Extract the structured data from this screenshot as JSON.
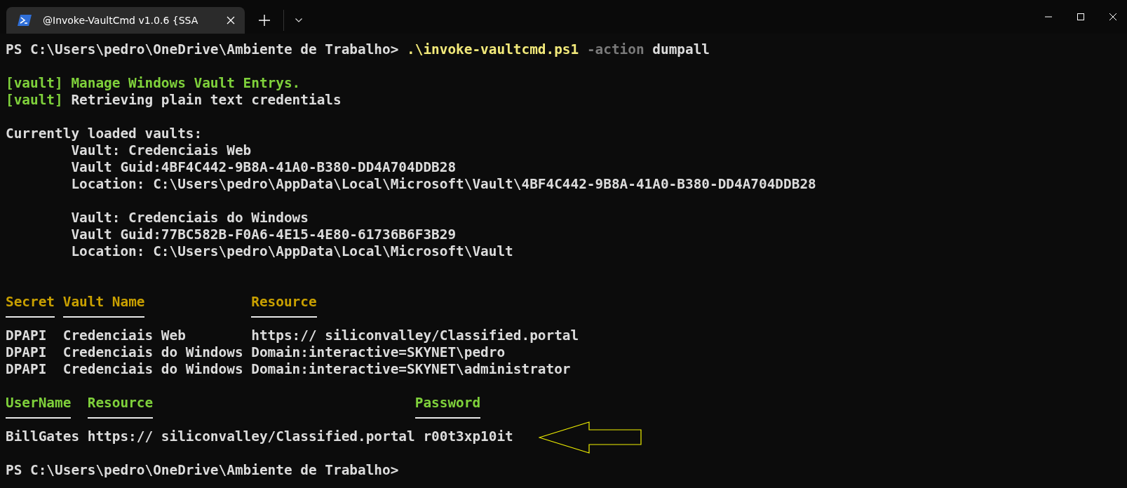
{
  "window": {
    "tab": {
      "title": "@Invoke-VaultCmd v1.0.6 {SSA",
      "selected": true
    }
  },
  "terminal": {
    "lines": [
      {
        "kind": "text",
        "segments": [
          {
            "text": "PS C:\\Users\\pedro\\OneDrive\\Ambiente de Trabalho> ",
            "color": "#dcdcdc"
          },
          {
            "text": ".\\invoke-vaultcmd.ps1",
            "color": "#f2e97a"
          },
          {
            "text": " -action",
            "color": "#7a7a7a"
          },
          {
            "text": " dumpall",
            "color": "#dcdcdc"
          }
        ]
      },
      {
        "kind": "blank"
      },
      {
        "kind": "text",
        "segments": [
          {
            "text": "[vault] Manage Windows Vault Entrys.",
            "color": "#7fd13b"
          }
        ]
      },
      {
        "kind": "text",
        "segments": [
          {
            "text": "[vault]",
            "color": "#7fd13b"
          },
          {
            "text": " Retrieving plain text credentials",
            "color": "#dcdcdc"
          }
        ]
      },
      {
        "kind": "blank"
      },
      {
        "kind": "text",
        "segments": [
          {
            "text": "Currently loaded vaults:",
            "color": "#dcdcdc"
          }
        ]
      },
      {
        "kind": "text",
        "segments": [
          {
            "text": "        Vault: Credenciais Web",
            "color": "#dcdcdc"
          }
        ]
      },
      {
        "kind": "text",
        "segments": [
          {
            "text": "        Vault Guid:4BF4C442-9B8A-41A0-B380-DD4A704DDB28",
            "color": "#dcdcdc"
          }
        ]
      },
      {
        "kind": "text",
        "segments": [
          {
            "text": "        Location: C:\\Users\\pedro\\AppData\\Local\\Microsoft\\Vault\\4BF4C442-9B8A-41A0-B380-DD4A704DDB28",
            "color": "#dcdcdc"
          }
        ]
      },
      {
        "kind": "blank"
      },
      {
        "kind": "text",
        "segments": [
          {
            "text": "        Vault: Credenciais do Windows",
            "color": "#dcdcdc"
          }
        ]
      },
      {
        "kind": "text",
        "segments": [
          {
            "text": "        Vault Guid:77BC582B-F0A6-4E15-4E80-61736B6F3B29",
            "color": "#dcdcdc"
          }
        ]
      },
      {
        "kind": "text",
        "segments": [
          {
            "text": "        Location: C:\\Users\\pedro\\AppData\\Local\\Microsoft\\Vault",
            "color": "#dcdcdc"
          }
        ]
      },
      {
        "kind": "blank"
      },
      {
        "kind": "blank"
      },
      {
        "kind": "header",
        "segments": [
          {
            "text": "Secret ",
            "color": "#c9a000"
          },
          {
            "text": "Vault Name             ",
            "color": "#c9a000"
          },
          {
            "text": "Resource",
            "color": "#c9a000"
          }
        ]
      },
      {
        "kind": "underline"
      },
      {
        "kind": "text",
        "segments": [
          {
            "text": "DPAPI  Credenciais Web        https:// siliconvalley/Classified.portal",
            "color": "#dcdcdc"
          }
        ]
      },
      {
        "kind": "text",
        "segments": [
          {
            "text": "DPAPI  Credenciais do Windows Domain:interactive=SKYNET\\pedro",
            "color": "#dcdcdc"
          }
        ]
      },
      {
        "kind": "text",
        "segments": [
          {
            "text": "DPAPI  Credenciais do Windows Domain:interactive=SKYNET\\administrator",
            "color": "#dcdcdc"
          }
        ]
      },
      {
        "kind": "blank"
      },
      {
        "kind": "header",
        "segments": [
          {
            "text": "UserName  ",
            "color": "#7fd13b"
          },
          {
            "text": "Resource                                ",
            "color": "#7fd13b"
          },
          {
            "text": "Password",
            "color": "#7fd13b"
          }
        ]
      },
      {
        "kind": "underline"
      },
      {
        "kind": "text",
        "arrow": true,
        "segments": [
          {
            "text": "BillGates https:// siliconvalley/Classified.portal r00t3xp10it",
            "color": "#dcdcdc"
          }
        ]
      },
      {
        "kind": "blank"
      },
      {
        "kind": "text",
        "segments": [
          {
            "text": "PS C:\\Users\\pedro\\OneDrive\\Ambiente de Trabalho>",
            "color": "#dcdcdc"
          }
        ]
      }
    ]
  }
}
